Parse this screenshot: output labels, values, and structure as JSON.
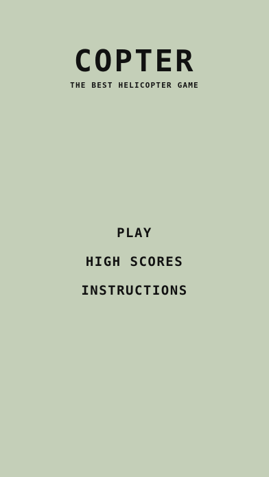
{
  "game": {
    "title": "COPTER",
    "subtitle": "THE BEST HELICOPTER GAME"
  },
  "menu": {
    "items": [
      {
        "label": "PLAY"
      },
      {
        "label": "HIGH SCORES"
      },
      {
        "label": "INSTRUCTIONS"
      }
    ]
  },
  "colors": {
    "background": "#c4cfb8",
    "text": "#111111"
  }
}
